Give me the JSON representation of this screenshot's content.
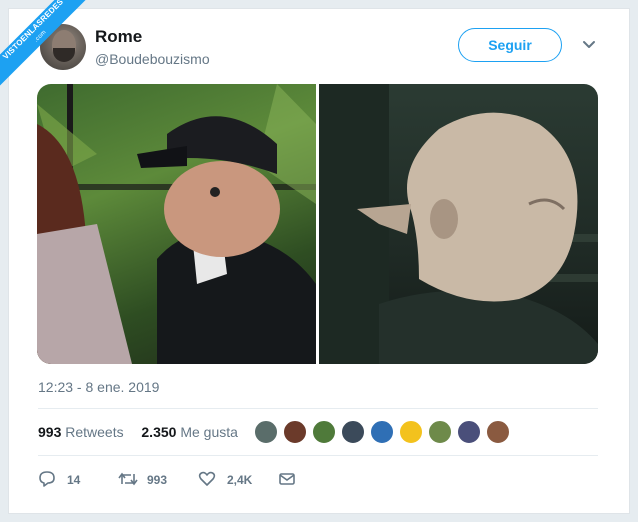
{
  "watermark": {
    "line1": "VISTOENLASREDES",
    "line2": ".com"
  },
  "user": {
    "name": "Rome",
    "handle": "@Boudebouzismo"
  },
  "follow_label": "Seguir",
  "timestamp": "12:23 - 8 ene. 2019",
  "stats": {
    "retweets_count": "993",
    "retweets_label": "Retweets",
    "likes_count": "2.350",
    "likes_label": "Me gusta"
  },
  "likers_colors": [
    "#5a6d6a",
    "#6b3a2a",
    "#4f7a3a",
    "#3b4a5a",
    "#2f6fb5",
    "#f3c21d",
    "#6e8a4a",
    "#4a4f7a",
    "#8a5a40"
  ],
  "actions": {
    "replies": "14",
    "retweets": "993",
    "likes": "2,4K"
  },
  "colors": {
    "accent": "#1da1f2",
    "text": "#14171a",
    "muted": "#657786"
  },
  "icons": [
    "caret-down-icon",
    "reply-icon",
    "retweet-icon",
    "heart-icon",
    "mail-icon"
  ]
}
